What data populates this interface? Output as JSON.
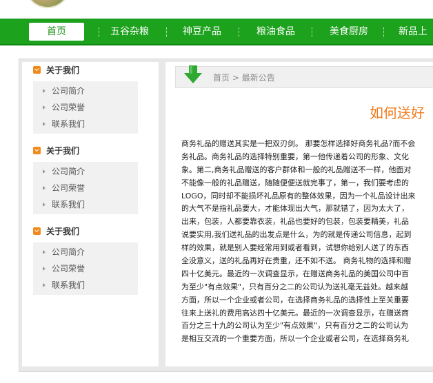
{
  "nav": {
    "items": [
      "首页",
      "五谷杂粮",
      "神豆产品",
      "粮油食品",
      "美食厨房",
      "新品上"
    ]
  },
  "sidebar": {
    "sections": [
      {
        "title": "关于我们",
        "items": [
          "公司简介",
          "公司荣誉",
          "联系我们"
        ]
      },
      {
        "title": "关于我们",
        "items": [
          "公司简介",
          "公司荣誉",
          "联系我们"
        ]
      },
      {
        "title": "关于我们",
        "items": [
          "公司简介",
          "公司荣誉",
          "联系我们"
        ]
      }
    ]
  },
  "breadcrumb": {
    "home": "首页",
    "separator": ">",
    "current": "最新公告"
  },
  "article": {
    "title": "如何送好",
    "lines": [
      "商务礼品的赠送其实是一把双刃剑。 那要怎样选择好商务礼品?而不会",
      "务礼品。商务礼品的选择特别重要，第一他传递着公司的形象、文化",
      "象。第二,商务礼品赠送的客户群体和一般的礼品赠送不一样，他面对",
      "不能像一般的礼品赠送，随随便便送就完事了，第一，我们要考虑的",
      "LOGO，同时却不能损坏礼品原有的整体效果，因为一个礼品设计出来",
      "的大气不是指礼品要大，才能体现出大气，那就错了，因为太大了，",
      "出来，包装，人都要靠衣装，礼品也要好的包装，包装要精美，礼品",
      "说要实用,我们送礼品的出发点是什么，为的就是传递公司信息，起到",
      "样的效果，就是别人要经常用到或者看到，试想你给别人送了的东西",
      "全没意义，送的礼品再好在贵重，还不如不送。 商务礼物的选择和赠",
      "四十亿美元。最近的一次调查显示，在赠送商务礼品的美国公司中百",
      "为至少\"有点效果\"，只有百分之二的公司认为送礼毫无益处。越来越",
      "方面，所以一个企业或者公司，在选择商务礼品的选择性上至关重要",
      "往来上送礼的费用高达四十亿美元。最近的一次调查显示，在赠送商",
      "百分之三十九的公司认为至少\"有点效果\"，只有百分之二的公司认为",
      "是相互交流的一个重要方面，所以一个企业或者公司，在选择商务礼"
    ]
  },
  "colors": {
    "nav_green": "#1ca21c",
    "accent_orange": "#f07a1a"
  }
}
